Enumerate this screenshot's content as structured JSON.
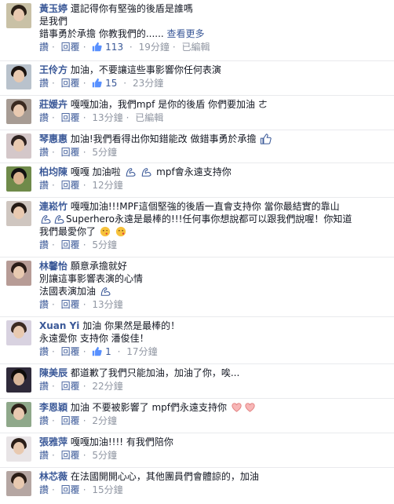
{
  "ui": {
    "like": "讚",
    "reply": "回覆",
    "edited": "已編輯"
  },
  "comments": [
    {
      "name": "黃玉婷",
      "lines": [
        "還記得你有堅強的後盾是誰嗎",
        "是我們",
        "錯事勇於承擔 你教我們的......"
      ],
      "see_more": "查看更多",
      "likes": "113",
      "time": "19分鐘",
      "edited": true
    },
    {
      "name": "王伶方",
      "lines": [
        "加油，不要讓這些事影響你任何表演"
      ],
      "likes": "15",
      "time": "23分鐘",
      "edited": false
    },
    {
      "name": "莊媛卉",
      "lines": [
        "嘎嘎加油，我們mpf 是你的後盾 你們要加油 ㄜ"
      ],
      "time": "13分鐘",
      "edited": true
    },
    {
      "name": "琴惠惠",
      "lines": [
        "加油!我們看得出你知錯能改 做錯事勇於承擔"
      ],
      "time": "5分鐘",
      "edited": false
    },
    {
      "name": "柏均陳",
      "lines": [
        "嘎嘎 加油啦",
        "mpf會永遠支持你"
      ],
      "time": "12分鐘",
      "edited": false
    },
    {
      "name": "連崧竹",
      "lines": [
        "嘎嘎加油!!!MPF這個堅強的後盾一直會支持你 當你最結實的靠山",
        "Superhero永遠是最棒的!!!任何事你想說都可以跟我們說喔！你知道",
        "我們最愛你了"
      ],
      "time": "5分鐘",
      "edited": false
    },
    {
      "name": "林馨怡",
      "lines": [
        "願意承擔就好",
        "別讓這事影響表演的心情",
        "法國表演加油"
      ],
      "time": "13分鐘",
      "edited": false
    },
    {
      "name": "Xuan Yi",
      "lines": [
        "加油 你果然是最棒的！",
        "永遠愛你 支持你 潘俊佳！"
      ],
      "likes": "1",
      "time": "17分鐘",
      "edited": false
    },
    {
      "name": "陳美辰",
      "lines": [
        "都道歉了我們只能加油，加油了你，唉..."
      ],
      "time": "22分鐘",
      "edited": false
    },
    {
      "name": "李恩穎",
      "lines": [
        "加油 不要被影響了 mpf們永遠支持你"
      ],
      "time": "2分鐘",
      "edited": false
    },
    {
      "name": "張雅萍",
      "lines": [
        "嘎嘎加油!!!! 有我們陪你"
      ],
      "time": "5分鐘",
      "edited": false
    },
    {
      "name": "林芯薇",
      "lines": [
        "在法國開開心心，其他團員們會體諒的，加油"
      ],
      "time": "15分鐘",
      "edited": false
    }
  ],
  "colors": {
    "link": "#3b5998",
    "meta": "#9197a3",
    "text": "#141823",
    "divider": "#e9eaed"
  }
}
